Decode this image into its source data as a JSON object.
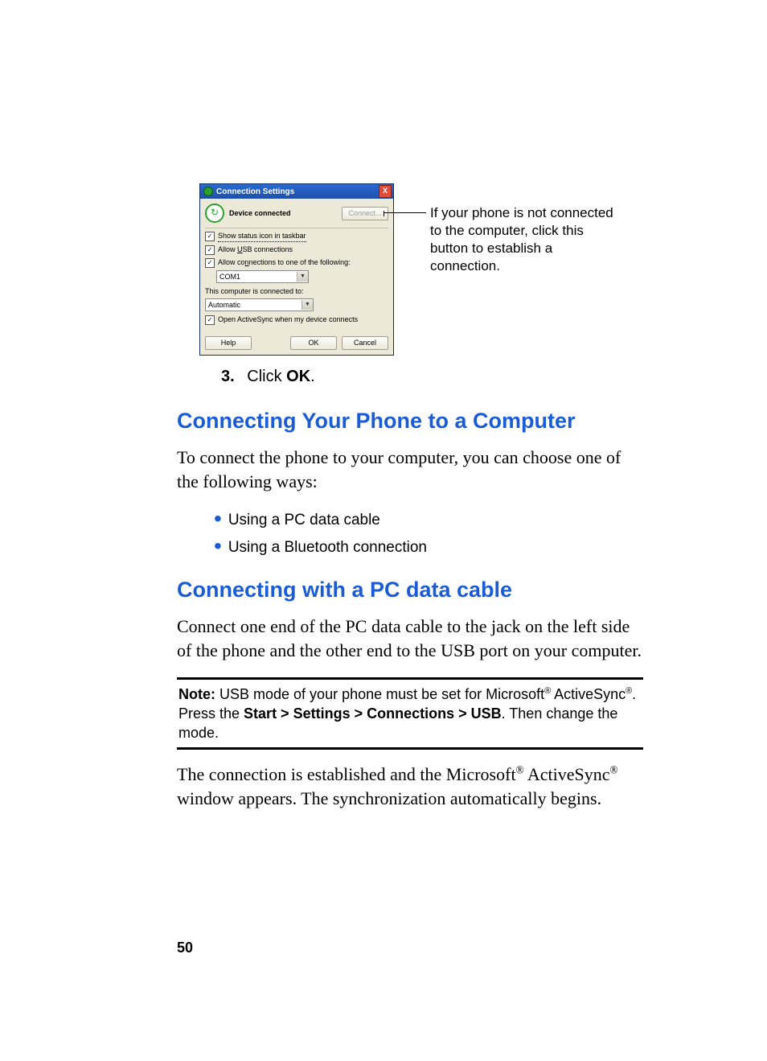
{
  "dialog": {
    "title": "Connection Settings",
    "close_glyph": "X",
    "status_glyph": "↻",
    "status_text": "Device connected",
    "connect_btn": "Connect...",
    "chk_show_status": "Show status icon in taskbar",
    "chk_allow_usb_prefix": "Allow ",
    "chk_allow_usb_u": "U",
    "chk_allow_usb_suffix": "SB connections",
    "chk_allow_conn_prefix": "Allow co",
    "chk_allow_conn_u": "n",
    "chk_allow_conn_suffix": "nections to one of the following:",
    "sel_com1": "COM1",
    "label_connected_to": "This computer is connected to:",
    "sel_automatic": "Automatic",
    "chk_open_activesync": "Open ActiveSync when my device connects",
    "btn_help_u": "H",
    "btn_help_suffix": "elp",
    "btn_ok": "OK",
    "btn_cancel": "Cancel",
    "checkmark": "✓",
    "arrow": "▼"
  },
  "callout": "If your phone is not connected to the computer, click this button to establish a connection.",
  "step3_num": "3.",
  "step3_a": "Click ",
  "step3_b": "OK",
  "step3_c": ".",
  "h2_a": "Connecting Your Phone to a Computer",
  "p1": "To connect the phone to your computer, you can choose one of the following ways:",
  "bullet1": "Using a PC data cable",
  "bullet2": "Using a Bluetooth connection",
  "h2_b": "Connecting with a PC data cable",
  "p2": "Connect one end of the PC data cable to the jack on the left side of the phone and the other end to the USB port on your computer.",
  "note_label": "Note:",
  "note_1": " USB mode of your phone must be set for Microsoft",
  "note_2": " ActiveSync",
  "note_3": ". Press the ",
  "note_path": "Start > Settings > Connections > USB",
  "note_4": ". Then change the mode.",
  "p3_a": "The connection is established and the Microsoft",
  "p3_b": " ActiveSync",
  "p3_c": " window appears. The synchronization automatically begins.",
  "reg": "®",
  "page_number": "50"
}
